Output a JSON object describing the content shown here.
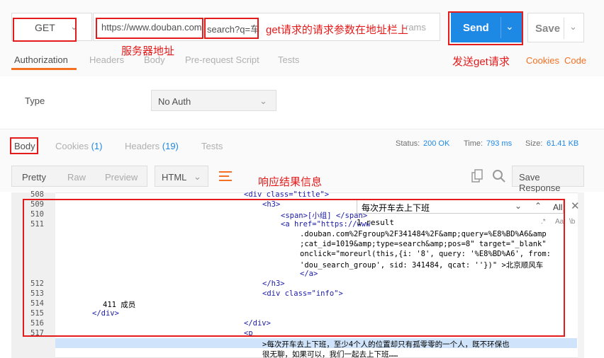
{
  "request": {
    "method": "GET",
    "url_base": "https://www.douban.com",
    "url_query": "search?q=车",
    "params_label": "rams",
    "send_label": "Send",
    "save_label": "Save"
  },
  "annotations": {
    "query_note": "get请求的请求参数在地址栏上",
    "server_note": "服务器地址",
    "send_note": "发送get请求",
    "response_note": "响应结果信息"
  },
  "request_tabs": [
    "Authorization",
    "Headers",
    "Body",
    "Pre-request Script",
    "Tests"
  ],
  "links": {
    "cookies": "Cookies",
    "code": "Code"
  },
  "auth": {
    "type_label": "Type",
    "type_value": "No Auth"
  },
  "response_tabs": {
    "body": "Body",
    "cookies": "Cookies",
    "cookies_count": "(1)",
    "headers": "Headers",
    "headers_count": "(19)",
    "tests": "Tests"
  },
  "status": {
    "status_label": "Status:",
    "status_value": "200 OK",
    "time_label": "Time:",
    "time_value": "793 ms",
    "size_label": "Size:",
    "size_value": "61.41 KB"
  },
  "view_modes": [
    "Pretty",
    "Raw",
    "Preview"
  ],
  "format": "HTML",
  "save_response": "Save Response",
  "search": {
    "query": "每次开车去上下班",
    "result_count": "1 result",
    "all_label": "All",
    "regex_label": ".*",
    "case_label": "Aa",
    "word_label": "\\b"
  },
  "code_lines": [
    {
      "n": "508",
      "text": "<div class=\"title\">"
    },
    {
      "n": "509",
      "text": "<h3>"
    },
    {
      "n": "510",
      "text": "<span>[小组] </span>"
    },
    {
      "n": "511",
      "text": "<a href=\"https://www"
    },
    {
      "n": "",
      "text": ".douban.com%2Fgroup%2F341484%2F&amp;query=%E8%BD%A6&amp"
    },
    {
      "n": "",
      "text": ";cat_id=1019&amp;type=search&amp;pos=8\" target=\"_blank\""
    },
    {
      "n": "",
      "text": "onclick=\"moreurl(this,{i: '8', query: '%E8%BD%A6', from:"
    },
    {
      "n": "",
      "text": "'dou_search_group', sid: 341484, qcat: ''})\" >北京顺风车"
    },
    {
      "n": "",
      "text": "</a>"
    },
    {
      "n": "512",
      "text": "</h3>"
    },
    {
      "n": "513",
      "text": "<div class=\"info\">"
    },
    {
      "n": "514",
      "text": "411 成员"
    },
    {
      "n": "515",
      "text": "</div>"
    },
    {
      "n": "516",
      "text": "</div>"
    },
    {
      "n": "517",
      "text": "<p"
    },
    {
      "n": "",
      "text": ">每次开车去上下班，至少4个人的位置却只有孤零零的一个人，既不环保也"
    },
    {
      "n": "",
      "text": "很无聊，如果可以，我们一起去上下班……"
    }
  ]
}
